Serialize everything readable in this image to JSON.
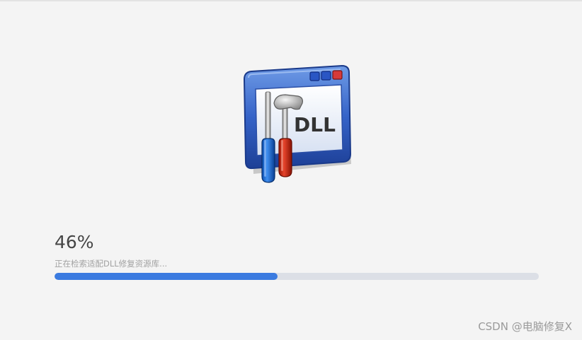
{
  "app_icon": {
    "icon": "dll-repair-tool-icon",
    "text": "DLL"
  },
  "progress": {
    "percent_label": "46%",
    "value": 0.46,
    "status_text": "正在检索适配DLL修复资源库..."
  },
  "watermark": {
    "text": "CSDN @电脑修复X"
  },
  "colors": {
    "background": "#f4f4f4",
    "progress_fill": "#3b7be0",
    "progress_track": "#dcdfe6",
    "percent_text": "#454545",
    "status_text": "#a2a2a2"
  }
}
